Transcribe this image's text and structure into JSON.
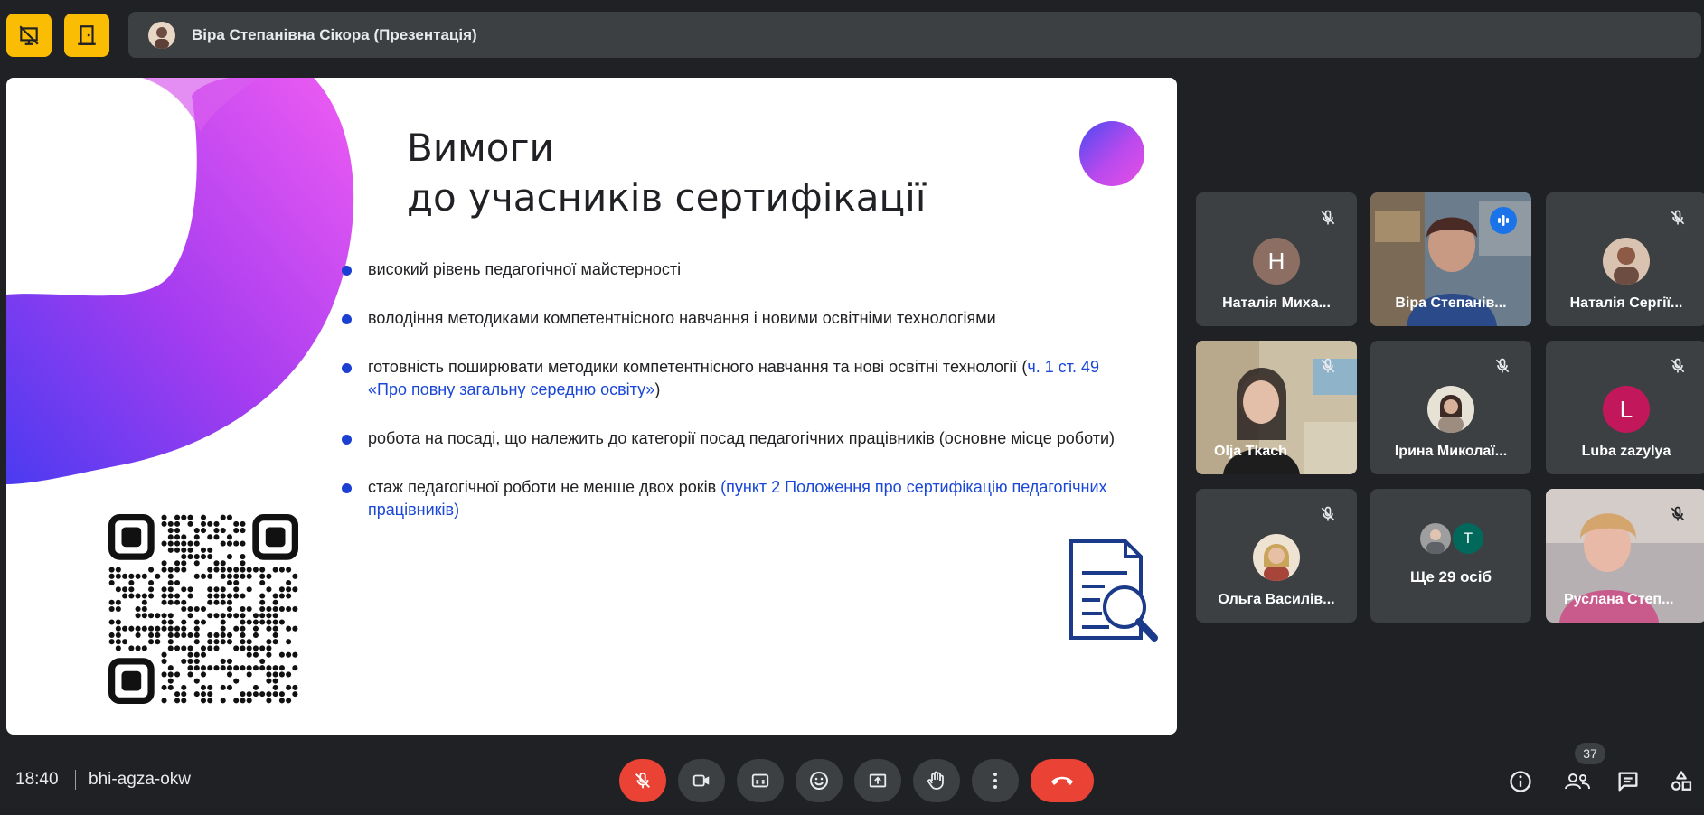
{
  "header": {
    "presenter_title": "Віра Степанівна Сікора (Презентація)"
  },
  "slide": {
    "title_line1": "Вимоги",
    "title_line2": "до учасників сертифікації",
    "bullets": [
      {
        "text": "високий рівень педагогічної майстерності"
      },
      {
        "text": "володіння методиками компетентнісного навчання і новими освітніми технологіями"
      },
      {
        "text": "готовність поширювати методики компетентнісного навчання та нові освітні технології (",
        "link": "ч. 1 ст. 49 «Про повну загальну середню освіту»",
        "after": ")"
      },
      {
        "text": "робота на посаді, що належить до категорії посад педагогічних працівників (основне місце роботи)"
      },
      {
        "text": "стаж педагогічної роботи не менше двох років ",
        "link": "(пункт 2 Положення про сертифікацію педагогічних працівників)"
      }
    ]
  },
  "participants": [
    {
      "name": "Наталія Миха...",
      "initial": "Н",
      "avatar_color": "#8d6e63"
    },
    {
      "name": "Віра Степанів..."
    },
    {
      "name": "Наталія Сергії..."
    },
    {
      "name": "Olja Tkach"
    },
    {
      "name": "Ірина Миколаї..."
    },
    {
      "name": "Luba zazylya",
      "initial": "L",
      "avatar_color": "#c2185b"
    },
    {
      "name": "Ольга Василів..."
    },
    {
      "name": "Ще 29 осіб",
      "initial": "T"
    },
    {
      "name": "Руслана Степ..."
    }
  ],
  "bottom": {
    "time": "18:40",
    "meeting_code": "bhi-agza-okw",
    "people_count": "37"
  },
  "colors": {
    "background": "#202124",
    "tile": "#3c4043",
    "accent_red": "#ea4335",
    "accent_yellow": "#fbbc04",
    "active_outline": "#8ab4f8"
  }
}
